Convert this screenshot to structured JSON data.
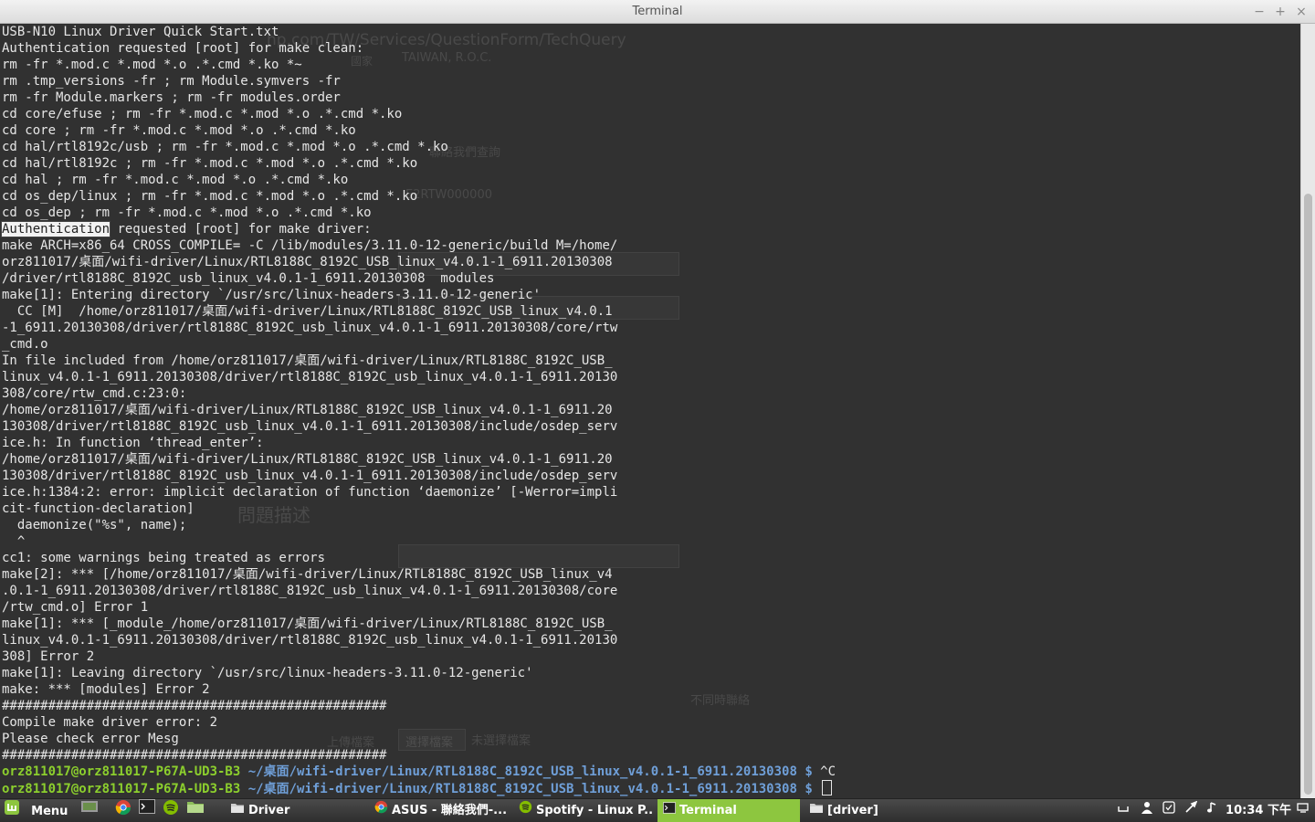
{
  "window": {
    "title": "Terminal",
    "minimize_glyph": "−",
    "maximize_glyph": "+",
    "close_glyph": "×"
  },
  "background_page": {
    "url_fragment": "hp.com/TW/Services/QuestionForm/TechQuery",
    "country_label": "國家",
    "country_value": "TAIWAN, R.O.C.",
    "link_text": "聯絡我們查詢",
    "field_value": "E2RTW000000",
    "section_heading": "問題描述",
    "link2_text": "不同時聯絡",
    "upload_label": "上傳檔案",
    "choose_button": "選擇檔案",
    "no_file_text": "未選擇檔案"
  },
  "terminal": {
    "lines": [
      "USB-N10 Linux Driver Quick Start.txt",
      "Authentication requested [root] for make clean:",
      "rm -fr *.mod.c *.mod *.o .*.cmd *.ko *~",
      "rm .tmp_versions -fr ; rm Module.symvers -fr",
      "rm -fr Module.markers ; rm -fr modules.order",
      "cd core/efuse ; rm -fr *.mod.c *.mod *.o .*.cmd *.ko",
      "cd core ; rm -fr *.mod.c *.mod *.o .*.cmd *.ko",
      "cd hal/rtl8192c/usb ; rm -fr *.mod.c *.mod *.o .*.cmd *.ko",
      "cd hal/rtl8192c ; rm -fr *.mod.c *.mod *.o .*.cmd *.ko",
      "cd hal ; rm -fr *.mod.c *.mod *.o .*.cmd *.ko",
      "cd os_dep/linux ; rm -fr *.mod.c *.mod *.o .*.cmd *.ko",
      "cd os_dep ; rm -fr *.mod.c *.mod *.o .*.cmd *.ko",
      "",
      "make ARCH=x86_64 CROSS_COMPILE= -C /lib/modules/3.11.0-12-generic/build M=/home/",
      "orz811017/桌面/wifi-driver/Linux/RTL8188C_8192C_USB_linux_v4.0.1-1_6911.20130308",
      "/driver/rtl8188C_8192C_usb_linux_v4.0.1-1_6911.20130308  modules",
      "make[1]: Entering directory `/usr/src/linux-headers-3.11.0-12-generic'",
      "  CC [M]  /home/orz811017/桌面/wifi-driver/Linux/RTL8188C_8192C_USB_linux_v4.0.1",
      "-1_6911.20130308/driver/rtl8188C_8192C_usb_linux_v4.0.1-1_6911.20130308/core/rtw",
      "_cmd.o",
      "In file included from /home/orz811017/桌面/wifi-driver/Linux/RTL8188C_8192C_USB_",
      "linux_v4.0.1-1_6911.20130308/driver/rtl8188C_8192C_usb_linux_v4.0.1-1_6911.20130",
      "308/core/rtw_cmd.c:23:0:",
      "/home/orz811017/桌面/wifi-driver/Linux/RTL8188C_8192C_USB_linux_v4.0.1-1_6911.20",
      "130308/driver/rtl8188C_8192C_usb_linux_v4.0.1-1_6911.20130308/include/osdep_serv",
      "ice.h: In function ‘thread_enter’:",
      "/home/orz811017/桌面/wifi-driver/Linux/RTL8188C_8192C_USB_linux_v4.0.1-1_6911.20",
      "130308/driver/rtl8188C_8192C_usb_linux_v4.0.1-1_6911.20130308/include/osdep_serv",
      "ice.h:1384:2: error: implicit declaration of function ‘daemonize’ [-Werror=impli",
      "cit-function-declaration]",
      "  daemonize(\"%s\", name);",
      "  ^",
      "cc1: some warnings being treated as errors",
      "make[2]: *** [/home/orz811017/桌面/wifi-driver/Linux/RTL8188C_8192C_USB_linux_v4",
      ".0.1-1_6911.20130308/driver/rtl8188C_8192C_usb_linux_v4.0.1-1_6911.20130308/core",
      "/rtw_cmd.o] Error 1",
      "make[1]: *** [_module_/home/orz811017/桌面/wifi-driver/Linux/RTL8188C_8192C_USB_",
      "linux_v4.0.1-1_6911.20130308/driver/rtl8188C_8192C_usb_linux_v4.0.1-1_6911.20130",
      "308] Error 2",
      "make[1]: Leaving directory `/usr/src/linux-headers-3.11.0-12-generic'",
      "make: *** [modules] Error 2",
      "##################################################",
      "Compile make driver error: 2",
      "Please check error Mesg",
      "##################################################"
    ],
    "auth_line": {
      "selected": "Authentication",
      "rest": " requested [root] for make driver:"
    },
    "prompt_user": "orz811017@orz811017-P67A-UD3-B3",
    "prompt_path": "~/桌面/wifi-driver/Linux/RTL8188C_8192C_USB_linux_v4.0.1-1_6911.20130308 $",
    "prompt1_cmd": " ^C",
    "prompt2_cmd": " "
  },
  "taskbar": {
    "menu_label": "Menu",
    "tasks": [
      {
        "label": "Driver",
        "active": false
      },
      {
        "label": "ASUS - 聯絡我們-...",
        "active": false
      },
      {
        "label": "Spotify - Linux P...",
        "active": false
      },
      {
        "label": "Terminal",
        "active": true
      },
      {
        "label": "[driver]",
        "active": false
      }
    ],
    "clock": "10:34 下午",
    "colors": {
      "active_task": "#8dc63f",
      "prompt_user": "#8ccf2d",
      "prompt_path": "#6f9fd8"
    }
  }
}
